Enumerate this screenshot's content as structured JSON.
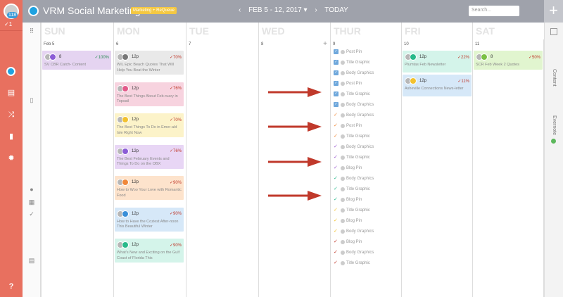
{
  "app": {
    "title": "VRM Social Marketing",
    "workspace": "Marketing + ReQueue"
  },
  "nav": {
    "badge": "118",
    "check_count": "✓1",
    "help": "?"
  },
  "header": {
    "prev": "‹",
    "range": "FEB 5 - 12, 2017 ▾",
    "next": "›",
    "today": "TODAY",
    "search_placeholder": "Search...",
    "add": "+"
  },
  "right_panel": {
    "content": "Content",
    "evernote": "Evernote"
  },
  "days": [
    {
      "name": "SUN",
      "date": "Feb 5"
    },
    {
      "name": "MON",
      "date": "6"
    },
    {
      "name": "TUE",
      "date": "7"
    },
    {
      "name": "WED",
      "date": "8"
    },
    {
      "name": "THUR",
      "date": "9"
    },
    {
      "name": "FRI",
      "date": "10"
    },
    {
      "name": "SAT",
      "date": "11"
    }
  ],
  "wed_plus": "+",
  "sun_cards": [
    {
      "time": "8",
      "pct": "✓100%",
      "title": "SV CBR Catch- Content",
      "bg": "#e5d4f1",
      "svc": "#8b5cd6"
    }
  ],
  "mon_cards": [
    {
      "time": "12p",
      "pct": "✓70%",
      "title": "WIL Epic Beach Quotes That Will Help You Beat the Winter",
      "bg": "#e9e9e9",
      "svc": "#777"
    },
    {
      "time": "12p",
      "pct": "✓76%",
      "title": "The Best Things About Feb-ruary in Topsail",
      "bg": "#f7d3df",
      "svc": "#e35a8a"
    },
    {
      "time": "12p",
      "pct": "✓70%",
      "title": "The Best Things To Do in Emer-ald Isle Right Now",
      "bg": "#fcf3c9",
      "svc": "#f2c12e"
    },
    {
      "time": "12p",
      "pct": "✓76%",
      "title": "The Best February Events and Things To Do on the OBX",
      "bg": "#e8d6f5",
      "svc": "#8b5cd6"
    },
    {
      "time": "12p",
      "pct": "✓90%",
      "title": "How to Woo Your Love with Romantic Food",
      "bg": "#fde3cc",
      "svc": "#f0883a"
    },
    {
      "time": "12p",
      "pct": "✓90%",
      "title": "How to Have the Coziest After-noon This Beautiful Winter",
      "bg": "#d6e8f8",
      "svc": "#3a8fd8"
    },
    {
      "time": "12p",
      "pct": "✓90%",
      "title": "What's New and Exciting on the Gulf Coast of Florida This",
      "bg": "#d4f4ea",
      "svc": "#27b98a"
    }
  ],
  "thur_items": [
    {
      "label": "Post Pin",
      "mark": "box",
      "color": "#6fa8dc"
    },
    {
      "label": "Title Graphic",
      "mark": "box",
      "color": "#6fa8dc"
    },
    {
      "label": "Body Graphics",
      "mark": "box",
      "color": "#6fa8dc"
    },
    {
      "label": "Post Pin",
      "mark": "box",
      "color": "#6fa8dc"
    },
    {
      "label": "Title Graphic",
      "mark": "box",
      "color": "#6fa8dc"
    },
    {
      "label": "Body Graphics",
      "mark": "box",
      "color": "#6fa8dc"
    },
    {
      "label": "Body Graphics",
      "mark": "check",
      "color": "#f08a3a"
    },
    {
      "label": "Post Pin",
      "mark": "check",
      "color": "#f08a3a"
    },
    {
      "label": "Title Graphic",
      "mark": "check",
      "color": "#f08a3a"
    },
    {
      "label": "Body Graphics",
      "mark": "check",
      "color": "#9b59d0"
    },
    {
      "label": "Title Graphic",
      "mark": "check",
      "color": "#9b59d0"
    },
    {
      "label": "Blog Pin",
      "mark": "check",
      "color": "#9b59d0"
    },
    {
      "label": "Body Graphics",
      "mark": "check",
      "color": "#27b98a"
    },
    {
      "label": "Title Graphic",
      "mark": "check",
      "color": "#27b98a"
    },
    {
      "label": "Blog Pin",
      "mark": "check",
      "color": "#27b98a"
    },
    {
      "label": "Title Graphic",
      "mark": "check",
      "color": "#f2c12e"
    },
    {
      "label": "Blog Pin",
      "mark": "check",
      "color": "#f2c12e"
    },
    {
      "label": "Body Graphics",
      "mark": "check",
      "color": "#f2c12e"
    },
    {
      "label": "Blog Pin",
      "mark": "check",
      "color": "#c0392b"
    },
    {
      "label": "Body Graphics",
      "mark": "check",
      "color": "#c0392b"
    },
    {
      "label": "Title Graphic",
      "mark": "check",
      "color": "#c0392b"
    }
  ],
  "fri_cards": [
    {
      "time": "12p",
      "pct": "✓22%",
      "title": "Plumtas Feb Newsletter",
      "bg": "#d4f4ea",
      "svc": "#27b98a"
    },
    {
      "time": "12p",
      "pct": "✓11%",
      "title": "Asheville Connections News-letter",
      "bg": "#d6e8f8",
      "svc": "#f2c12e"
    }
  ],
  "sat_cards": [
    {
      "time": "8",
      "pct": "✓50%",
      "title": "SCR Feb Week 2 Quotes",
      "bg": "#e1f5cf",
      "svc": "#7bc043"
    }
  ]
}
